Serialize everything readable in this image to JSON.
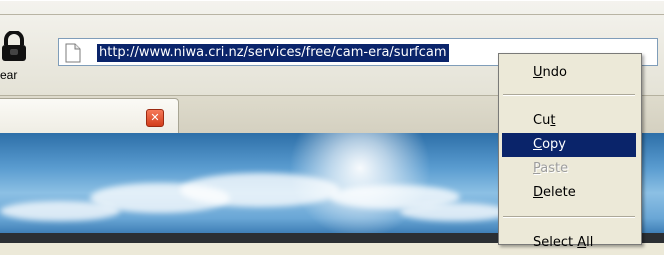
{
  "toolbar": {
    "clear_label": "ear",
    "address": {
      "url": "http://www.niwa.cri.nz/services/free/cam-era/surfcam"
    }
  },
  "tab": {
    "close_glyph": "✕"
  },
  "context_menu": {
    "items": [
      {
        "label": "Undo",
        "accel_index": 0,
        "state": "normal"
      },
      {
        "label": "Cut",
        "accel_index": 2,
        "state": "normal"
      },
      {
        "label": "Copy",
        "accel_index": 0,
        "state": "selected"
      },
      {
        "label": "Paste",
        "accel_index": 0,
        "state": "disabled"
      },
      {
        "label": "Delete",
        "accel_index": 0,
        "state": "normal"
      },
      {
        "label": "Select All",
        "accel_index": 7,
        "state": "normal"
      }
    ]
  },
  "colors": {
    "selection": "#0a246a",
    "menu_bg": "#ece9d8",
    "tab_close": "#d23d1b"
  },
  "icons": [
    "padlock-icon",
    "page-icon",
    "close-icon"
  ]
}
